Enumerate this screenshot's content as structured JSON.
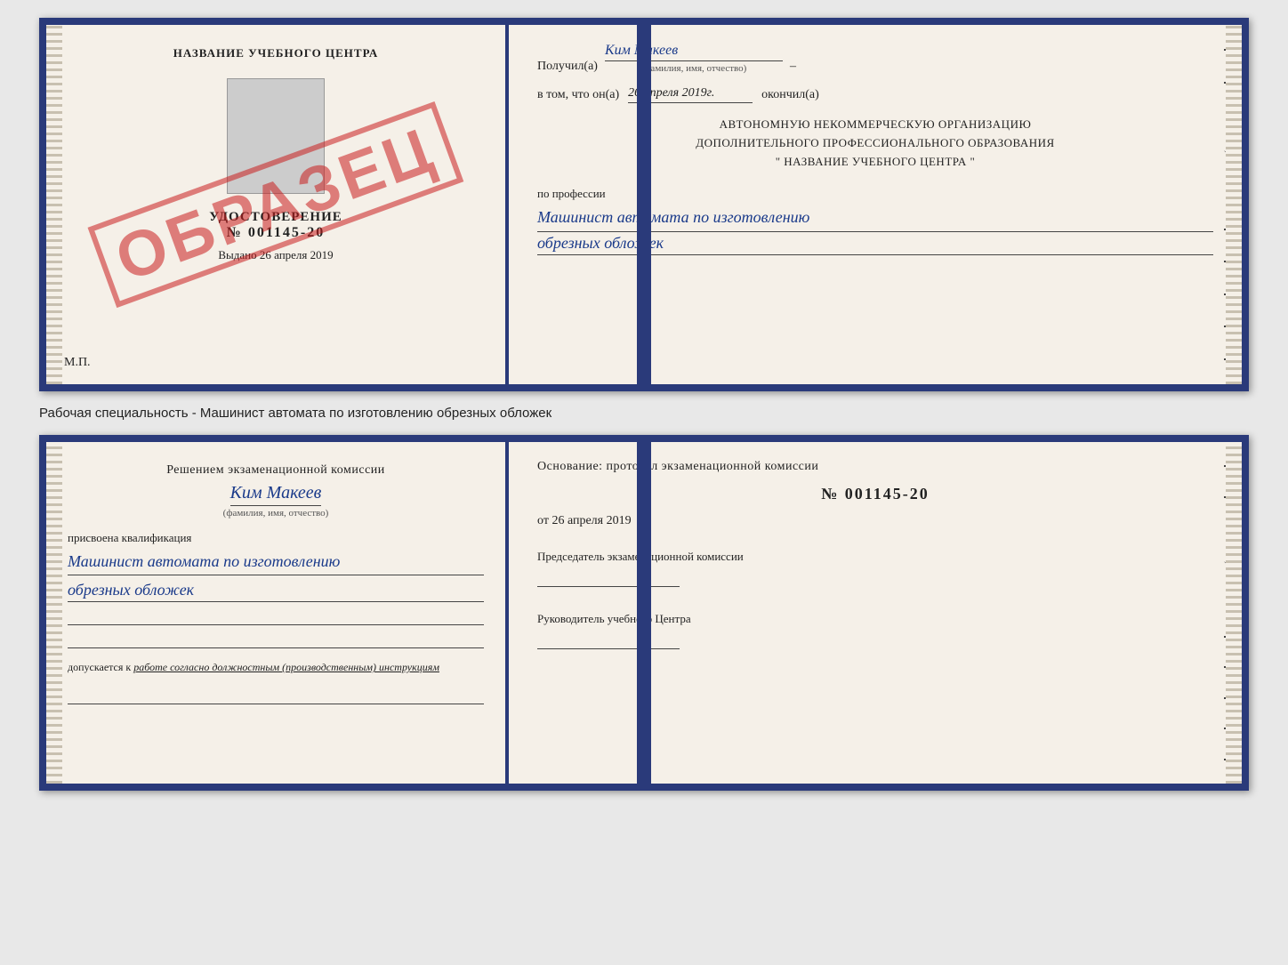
{
  "top_doc": {
    "left": {
      "school_name": "НАЗВАНИЕ УЧЕБНОГО ЦЕНТРА",
      "cert_title": "УДОСТОВЕРЕНИЕ",
      "cert_number": "№ 001145-20",
      "issued_label": "Выдано",
      "issued_date": "26 апреля 2019",
      "mp_label": "М.П.",
      "stamp_text": "ОБРАЗЕЦ"
    },
    "right": {
      "received_prefix": "Получил(а)",
      "received_name": "Ким Макеев",
      "received_subtitle": "(фамилия, имя, отчество)",
      "in_that_prefix": "в том, что он(а)",
      "in_that_date": "26 апреля 2019г.",
      "in_that_suffix": "окончил(а)",
      "org_line1": "АВТОНОМНУЮ НЕКОММЕРЧЕСКУЮ ОРГАНИЗАЦИЮ",
      "org_line2": "ДОПОЛНИТЕЛЬНОГО ПРОФЕССИОНАЛЬНОГО ОБРАЗОВАНИЯ",
      "org_line3": "\"   НАЗВАНИЕ УЧЕБНОГО ЦЕНТРА   \"",
      "profession_label": "по профессии",
      "profession_value1": "Машинист автомата по изготовлению",
      "profession_value2": "обрезных обложек"
    }
  },
  "caption": {
    "text": "Рабочая специальность - Машинист автомата по изготовлению обрезных обложек"
  },
  "bottom_doc": {
    "left": {
      "decision_title": "Решением экзаменационной комиссии",
      "person_name": "Ким Макеев",
      "person_subtitle": "(фамилия, имя, отчество)",
      "qualification_label": "присвоена квалификация",
      "qualification_value1": "Машинист автомата по изготовлению",
      "qualification_value2": "обрезных обложек",
      "allow_prefix": "допускается к",
      "allow_value": "работе согласно должностным (производственным) инструкциям"
    },
    "right": {
      "basis_title": "Основание: протокол экзаменационной комиссии",
      "protocol_number": "№ 001145-20",
      "protocol_date_prefix": "от",
      "protocol_date": "26 апреля 2019",
      "chairman_label": "Председатель экзаменационной комиссии",
      "director_label": "Руководитель учебного Центра"
    }
  }
}
